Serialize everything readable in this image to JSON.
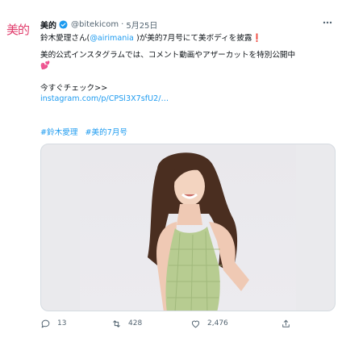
{
  "account": {
    "avatar_text": "美的",
    "name": "美的",
    "handle": "@bitekicom",
    "separator": "·",
    "date": "5月25日"
  },
  "tweet": {
    "line1_pre": "鈴木愛理さん(",
    "line1_mention": "@airimania",
    "line1_post": " )が美的7月号にて美ボディを披露",
    "line1_emoji": "❗",
    "line2": "美的公式インスタグラムでは、コメント動画やアザーカットを特別公開中",
    "line2_emoji": "💕",
    "line3": "今すぐチェック>>",
    "link": "instagram.com/p/CPSl3X7sfU2/…",
    "hashtags": [
      "#鈴木愛理",
      "#美的7月号"
    ]
  },
  "actions": {
    "replies": "13",
    "retweets": "428",
    "likes": "2,476"
  },
  "colors": {
    "accent": "#1d9bf0",
    "brand": "#e03b6b",
    "muted": "#536471"
  },
  "icons": [
    "verified-badge-icon",
    "more-icon",
    "reply-icon",
    "retweet-icon",
    "like-icon",
    "share-icon"
  ]
}
